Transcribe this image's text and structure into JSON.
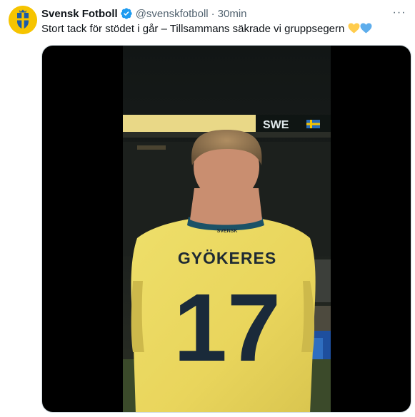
{
  "account": {
    "name": "Svensk Fotboll",
    "handle": "@svenskfotboll",
    "separator": "·",
    "time": "30min",
    "verified_color": "#1d9bf0"
  },
  "tweet": {
    "text": "Stort tack för stödet i går – Tillsammans säkrade vi gruppsegern",
    "emojis": [
      "yellow-heart",
      "blue-heart"
    ]
  },
  "more_menu": "···",
  "video": {
    "scoreboard_text": "SWE",
    "jersey_sponsor": "SVENSK",
    "jersey_name": "GYÖKERES",
    "jersey_number": "17",
    "jersey_color": "#f2df62"
  }
}
